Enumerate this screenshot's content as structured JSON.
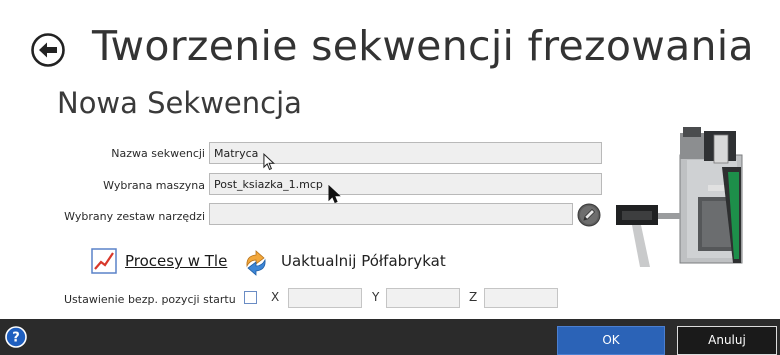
{
  "header": {
    "title": "Tworzenie sekwencji frezowania",
    "back_icon": "back-arrow-icon"
  },
  "section": {
    "title": "Nowa Sekwencja"
  },
  "form": {
    "sequence_name": {
      "label": "Nazwa sekwencji",
      "value": "Matryca"
    },
    "machine": {
      "label": "Wybrana maszyna",
      "value": "Post_ksiazka_1.mcp"
    },
    "toolset": {
      "label": "Wybrany zestaw narzędzi",
      "value": "",
      "edit_icon": "pencil-edit-icon"
    }
  },
  "actions": {
    "background_processes": {
      "label": "Procesy w Tle",
      "icon": "chart-line-icon"
    },
    "update_stock": {
      "label": "Uaktualnij Półfabrykat",
      "icon": "refresh-stock-icon"
    }
  },
  "safe_start": {
    "label": "Ustawienie bezp. pozycji startu",
    "checked": false,
    "x_label": "X",
    "x_value": "",
    "y_label": "Y",
    "y_value": "",
    "z_label": "Z",
    "z_value": ""
  },
  "footer": {
    "help_icon": "help-icon",
    "help_glyph": "?",
    "ok_label": "OK",
    "cancel_label": "Anuluj"
  },
  "colors": {
    "footer_bg": "#2b2b2b",
    "ok_button": "#2b63b7",
    "link_text": "#1a1a1a"
  }
}
